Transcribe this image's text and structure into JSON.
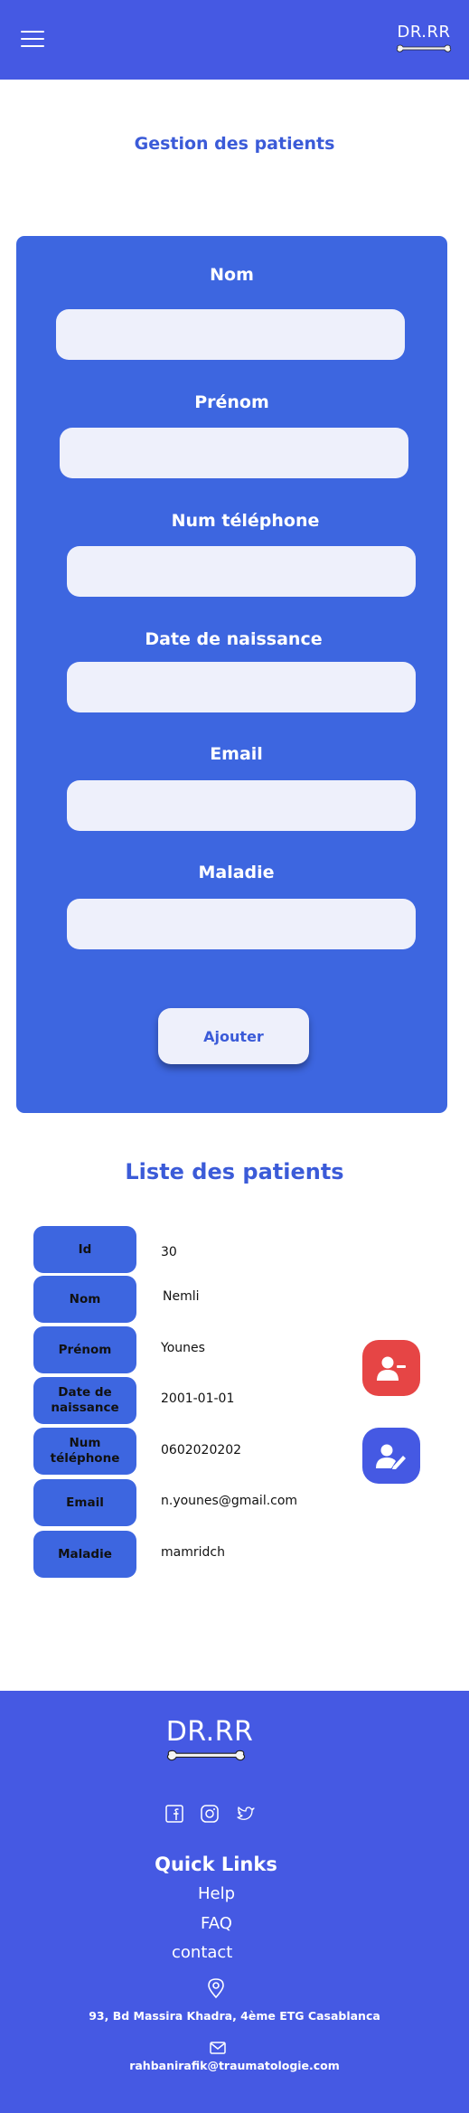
{
  "header": {
    "logo_text": "DR.RR"
  },
  "page_title": "Gestion des patients",
  "form": {
    "fields": [
      {
        "label": "Nom",
        "value": ""
      },
      {
        "label": "Prénom",
        "value": ""
      },
      {
        "label": "Num téléphone",
        "value": ""
      },
      {
        "label": "Date de naissance",
        "value": ""
      },
      {
        "label": "Email",
        "value": ""
      },
      {
        "label": "Maladie",
        "value": ""
      }
    ],
    "submit_label": "Ajouter"
  },
  "list_title": "Liste des patients",
  "patient": {
    "rows": [
      {
        "key": "Id",
        "value": "30"
      },
      {
        "key": "Nom",
        "value": "Nemli"
      },
      {
        "key": "Prénom",
        "value": "Younes"
      },
      {
        "key": "Date de naissance",
        "value": "2001-01-01"
      },
      {
        "key": "Num téléphone",
        "value": "0602020202"
      },
      {
        "key": "Email",
        "value": "n.younes@gmail.com"
      },
      {
        "key": "Maladie",
        "value": "mamridch"
      }
    ]
  },
  "actions": {
    "delete_icon": "user-minus-icon",
    "edit_icon": "user-edit-icon",
    "delete_color": "#e64545",
    "edit_color": "#4559e3"
  },
  "footer": {
    "logo_text": "DR.RR",
    "social_icons": [
      "facebook-icon",
      "instagram-icon",
      "twitter-icon"
    ],
    "quick_links_title": "Quick Links",
    "links": [
      "Help",
      "FAQ",
      "contact"
    ],
    "address": "93, Bd Massira Khadra, 4ème ETG Casablanca",
    "email": "rahbanirafik@traumatologie.com"
  },
  "colors": {
    "primary": "#4559e3",
    "card": "#3d66e0",
    "title": "#3b5bd8",
    "input_bg": "#eef0fb"
  }
}
